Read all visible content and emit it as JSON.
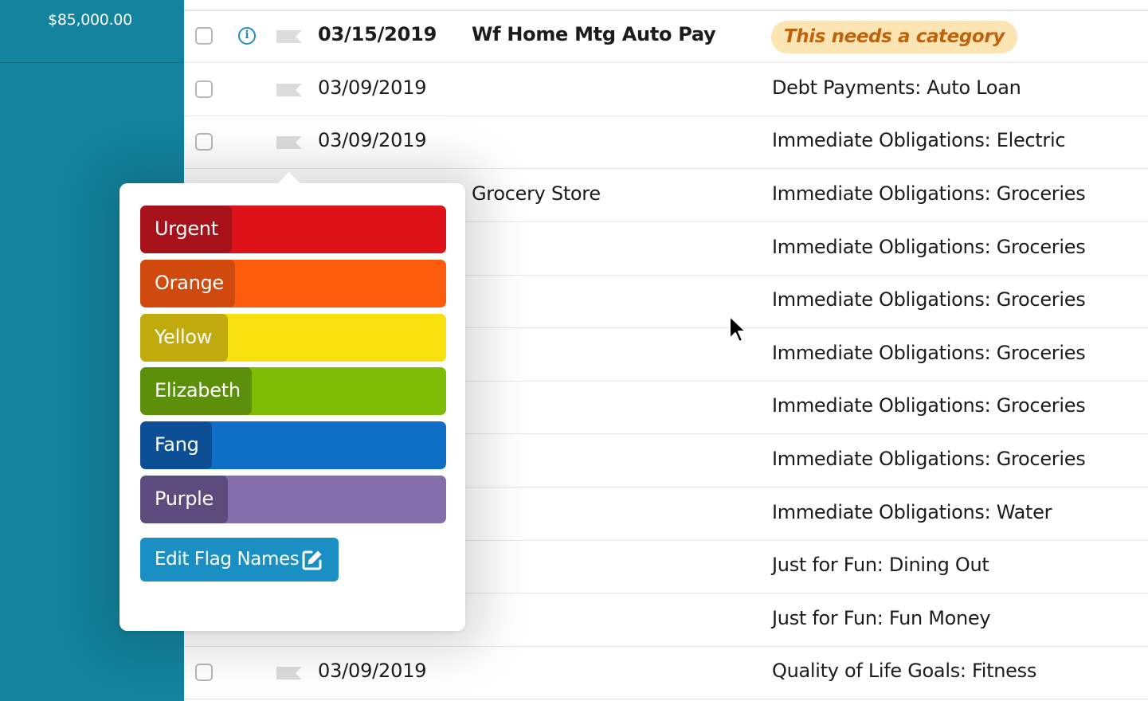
{
  "sidebar": {
    "amount": "$85,000.00"
  },
  "rows": [
    {
      "date": "03/15/2019",
      "payee": "Wf Home Mtg Auto Pay",
      "category": "This needs a category"
    },
    {
      "date": "03/09/2019",
      "payee": "",
      "category": "Debt Payments: Auto Loan"
    },
    {
      "date": "03/09/2019",
      "payee": "",
      "category": "Immediate Obligations: Electric"
    },
    {
      "date": "",
      "payee": "Grocery Store",
      "category": "Immediate Obligations: Groceries"
    },
    {
      "date": "",
      "payee": "",
      "category": "Immediate Obligations: Groceries"
    },
    {
      "date": "",
      "payee": "",
      "category": "Immediate Obligations: Groceries"
    },
    {
      "date": "",
      "payee": "",
      "category": "Immediate Obligations: Groceries"
    },
    {
      "date": "",
      "payee": "",
      "category": "Immediate Obligations: Groceries"
    },
    {
      "date": "",
      "payee": "",
      "category": "Immediate Obligations: Groceries"
    },
    {
      "date": "",
      "payee": "",
      "category": "Immediate Obligations: Water"
    },
    {
      "date": "",
      "payee": "",
      "category": "Just for Fun: Dining Out"
    },
    {
      "date": "",
      "payee": "",
      "category": "Just for Fun: Fun Money"
    },
    {
      "date": "03/09/2019",
      "payee": "",
      "category": "Quality of Life Goals: Fitness"
    }
  ],
  "flag_popover": {
    "options": [
      {
        "label": "Urgent",
        "color": "#de1219",
        "dark": "#a6111a"
      },
      {
        "label": "Orange",
        "color": "#fe5c0d",
        "dark": "#d04a0e"
      },
      {
        "label": "Yellow",
        "color": "#f6e00d",
        "dark": "#c0aa0c"
      },
      {
        "label": "Elizabeth",
        "color": "#7fbc06",
        "dark": "#5c8f0a"
      },
      {
        "label": "Fang",
        "color": "#0f6fc6",
        "dark": "#0d4f95"
      },
      {
        "label": "Purple",
        "color": "#856eac",
        "dark": "#5c4c7e"
      }
    ],
    "edit_label": "Edit Flag Names",
    "edit_icon": "pencil-square-icon"
  },
  "colors": {
    "sidebar": "#13839e",
    "needs_category_bg": "#fde4b3",
    "needs_category_text": "#c0620c",
    "info_icon": "#1f8fc3",
    "flag_empty": "#dcdcdc",
    "edit_button": "#1a8fc3"
  }
}
